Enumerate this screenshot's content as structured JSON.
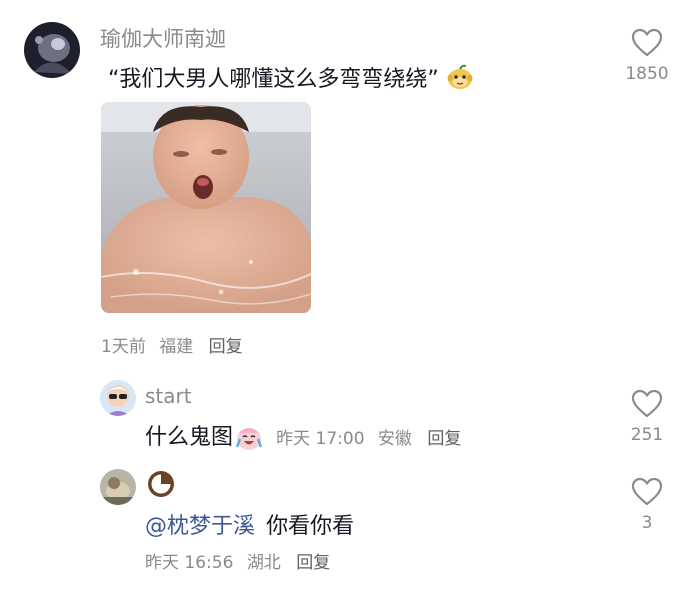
{
  "comments": [
    {
      "username": "瑜伽大师南迦",
      "text": "“我们大男人哪懂这么多弯弯绕绕”",
      "emoji_icon": "monkey-face-emoji",
      "meta": {
        "time": "1天前",
        "location": "福建",
        "reply": "回复"
      },
      "likes": "1850",
      "has_image": true
    }
  ],
  "replies": [
    {
      "username": "start",
      "text": "什么鬼图",
      "emoji_icon": "crying-laughing-emoji",
      "meta": {
        "time": "昨天 17:00",
        "location": "安徽",
        "reply": "回复"
      },
      "likes": "251"
    },
    {
      "username_icon": "coconut-icon",
      "mention": "@枕梦于溪",
      "text": "你看你看",
      "meta": {
        "time": "昨天 16:56",
        "location": "湖北",
        "reply": "回复"
      },
      "likes": "3"
    }
  ],
  "icons": {
    "like": "heart-outline-icon"
  },
  "colors": {
    "muted": "#8a8a8a",
    "mention": "#3b5998",
    "text": "#161823"
  }
}
